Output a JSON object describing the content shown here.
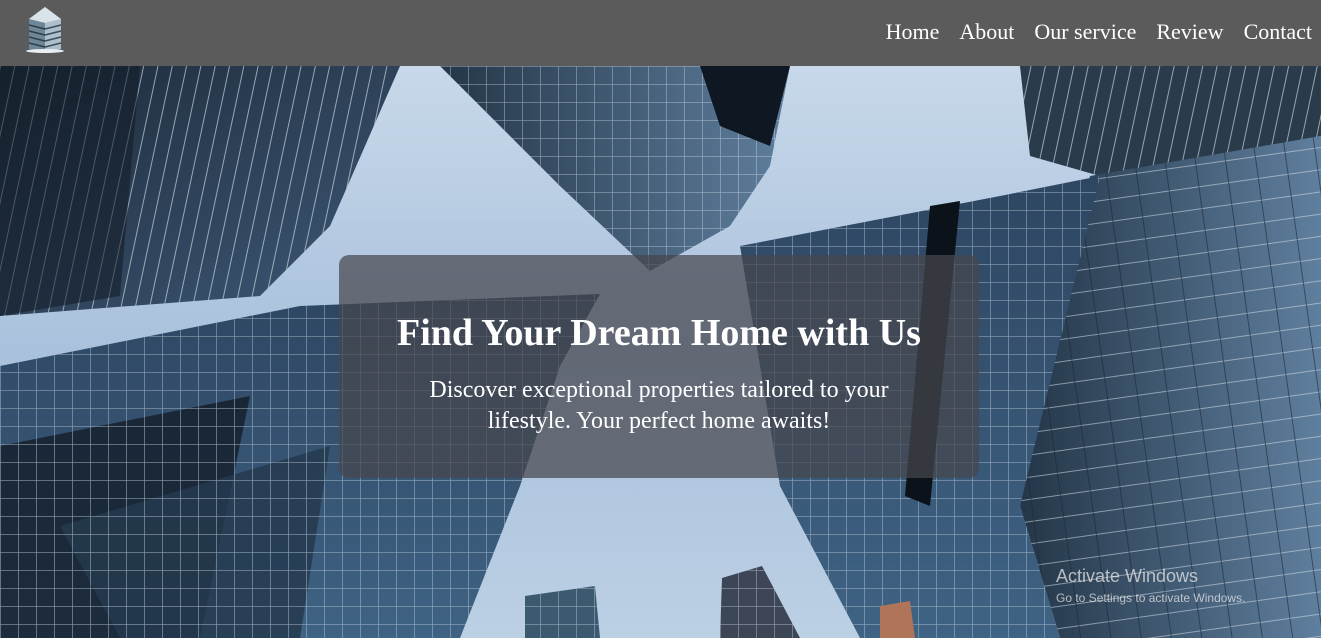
{
  "navbar": {
    "logo_icon": "building-logo-icon",
    "links": [
      "Home",
      "About",
      "Our service",
      "Review",
      "Contact"
    ]
  },
  "hero": {
    "title": "Find Your Dream Home with Us",
    "subtitle": "Discover exceptional properties tailored to your lifestyle. Your perfect home awaits!"
  },
  "watermark": {
    "title": "Activate Windows",
    "subtitle": "Go to Settings to activate Windows."
  },
  "colors": {
    "navbar_bg": "#5b5b5b",
    "nav_text": "#ffffff",
    "card_bg": "rgba(70,70,78,0.72)"
  }
}
